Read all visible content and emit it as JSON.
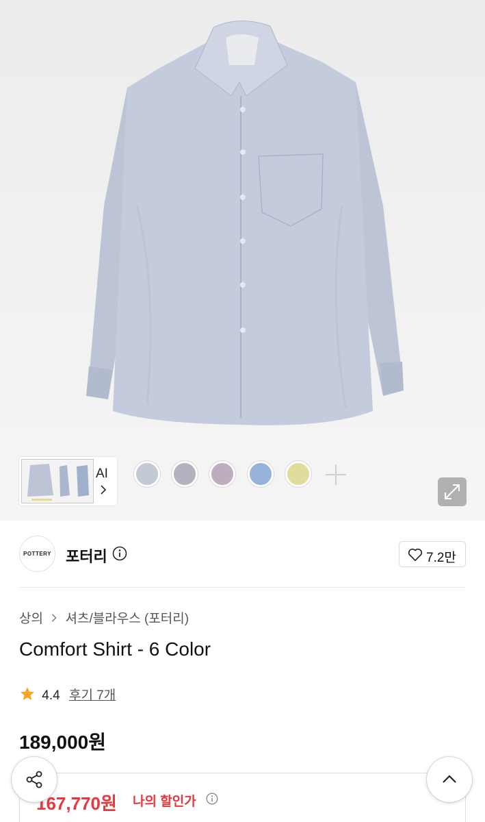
{
  "gallery": {
    "thumbnail_label": "AI",
    "swatches": [
      {
        "name": "swatch-gray-blue",
        "color": "#c3cad3"
      },
      {
        "name": "swatch-gray-lavender",
        "color": "#b5b2bf"
      },
      {
        "name": "swatch-mauve",
        "color": "#bdaebd"
      },
      {
        "name": "swatch-blue",
        "color": "#97b3da"
      },
      {
        "name": "swatch-yellow",
        "color": "#dfdc9e"
      }
    ]
  },
  "brand": {
    "logo_text": "POTTERY",
    "name": "포터리",
    "likes": "7.2만"
  },
  "breadcrumb": {
    "category": "상의",
    "subcategory": "셔츠/블라우스 (포터리)"
  },
  "product": {
    "title": "Comfort Shirt - 6 Color",
    "rating": "4.4",
    "reviews_label": "후기 7개",
    "price": "189,000원"
  },
  "discount": {
    "price": "167,770원",
    "label": "나의 할인가"
  },
  "colors": {
    "shirt": "#c3cbdc",
    "discount_red": "#e8383d",
    "star": "#f5a623"
  }
}
